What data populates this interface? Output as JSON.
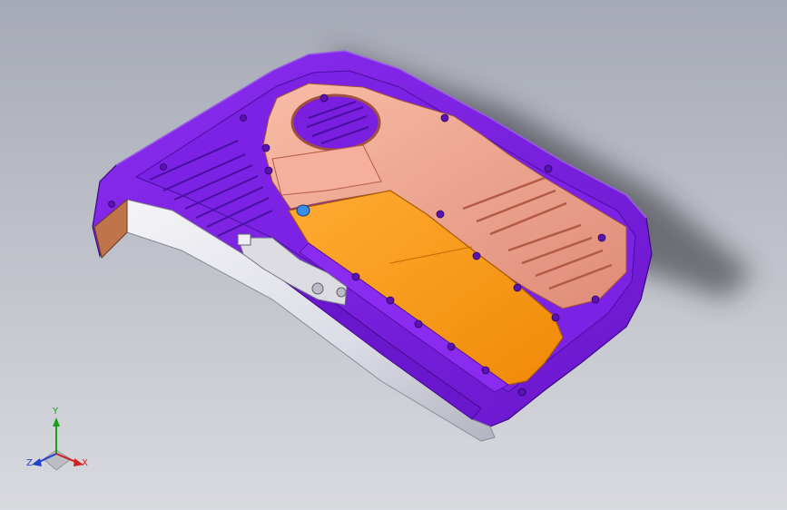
{
  "viewport": {
    "background_top": "#a6aab6",
    "background_bottom": "#d9dadf"
  },
  "model": {
    "colors": {
      "shell": "#7a1ee0",
      "shell_dark": "#5a12b0",
      "shell_light": "#9c52f0",
      "inner_trim": "#f0a890",
      "inner_trim_dark": "#c8705e",
      "panel": "#ff9a1a",
      "panel_dark": "#e07a00",
      "side_face": "#e6e6ee",
      "side_face_dark": "#a8a8b4",
      "mechanism": "#d8d8de",
      "clip_blue": "#3a8ee8"
    }
  },
  "triad": {
    "x_label": "X",
    "y_label": "Y",
    "z_label": "Z",
    "x_color": "#d02020",
    "y_color": "#18a018",
    "z_color": "#2040d0"
  }
}
